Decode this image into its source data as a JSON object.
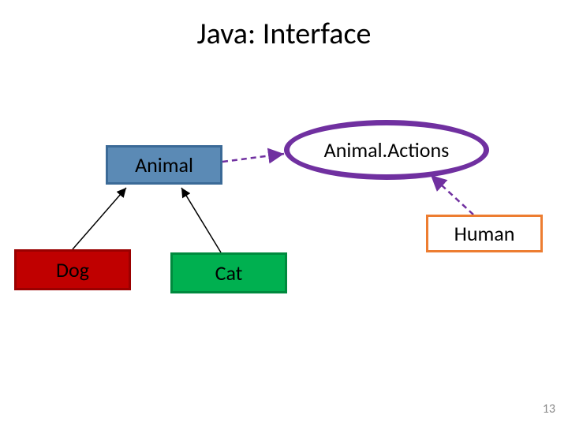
{
  "title": "Java: Interface",
  "nodes": {
    "animal": "Animal",
    "actions": "Animal.Actions",
    "dog": "Dog",
    "cat": "Cat",
    "human": "Human"
  },
  "page_number": "13"
}
